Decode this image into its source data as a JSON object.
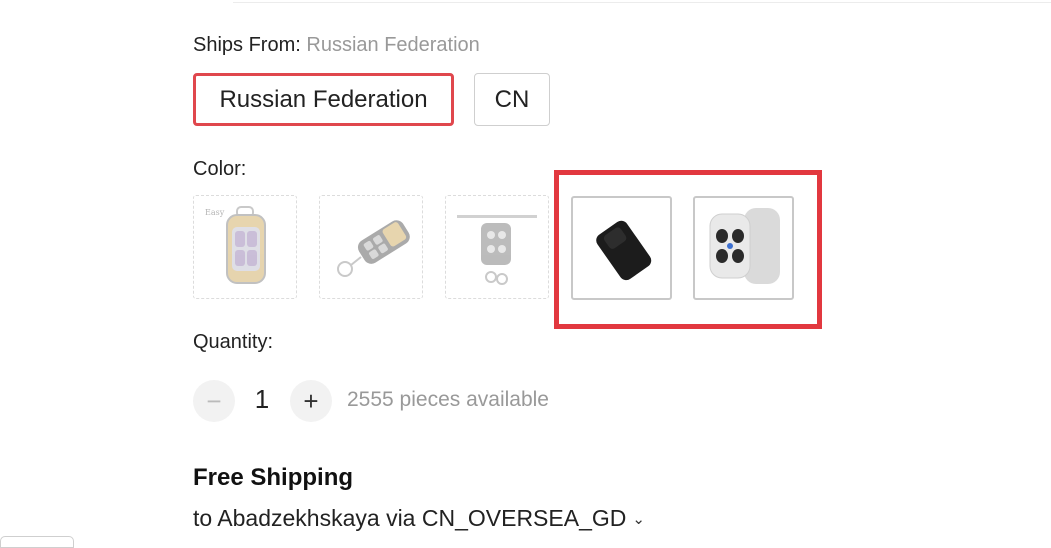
{
  "ships_from": {
    "label": "Ships From:",
    "selected_value": "Russian Federation",
    "options": [
      {
        "label": "Russian Federation",
        "selected": true
      },
      {
        "label": "CN",
        "selected": false
      }
    ]
  },
  "color": {
    "label": "Color:",
    "swatches": [
      {
        "icon": "gold-keyfob-thumbnail",
        "available": false
      },
      {
        "icon": "keyfob-keychain-thumbnail",
        "available": false
      },
      {
        "icon": "keyfob-rail-thumbnail",
        "available": false
      },
      {
        "icon": "black-keyfob-thumbnail",
        "available": true
      },
      {
        "icon": "grey-keyfob-thumbnail",
        "available": true
      }
    ],
    "highlight_color": "#e2383f"
  },
  "quantity": {
    "label": "Quantity:",
    "value": "1",
    "minus_symbol": "−",
    "plus_symbol": "+",
    "available_text": "2555 pieces available"
  },
  "shipping": {
    "title": "Free Shipping",
    "destination": "to Abadzekhskaya via CN_OVERSEA_GD",
    "chevron": "⌄"
  },
  "colors": {
    "selected_border": "#e0474d",
    "muted_text": "#999999"
  }
}
